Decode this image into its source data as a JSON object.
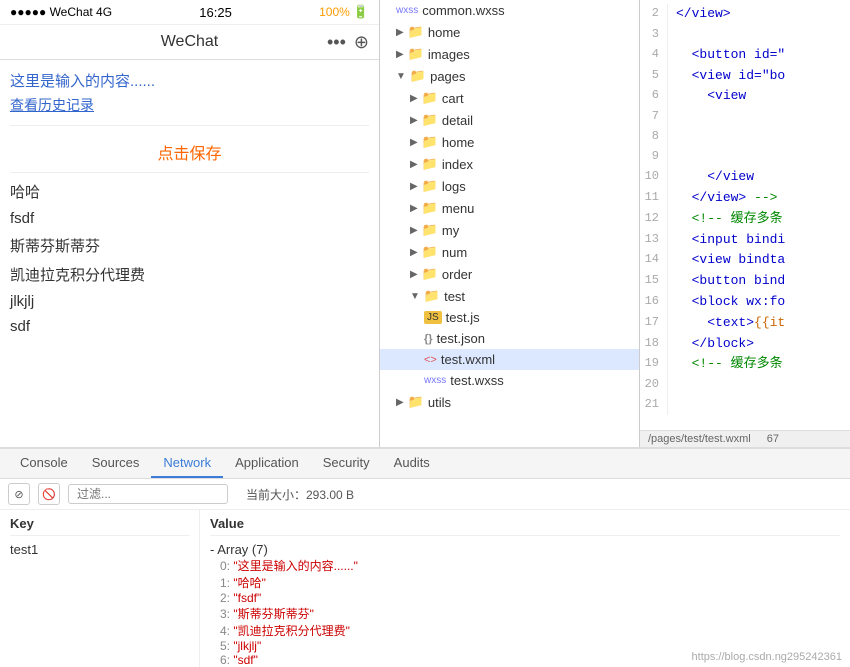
{
  "phone": {
    "status": {
      "signal": "●●●●● WeChat 4G",
      "time": "16:25",
      "battery": "100%",
      "battery_icon": "🔋"
    },
    "nav": {
      "title": "WeChat",
      "icon_dots": "•••",
      "icon_add": "⊕"
    },
    "content": {
      "input_text": "这里是输入的内容......",
      "link_text": "查看历史记录",
      "save_button": "点击保存",
      "list_items": [
        "哈哈",
        "fsdf",
        "斯蒂芬斯蒂芬",
        "凯迪拉克积分代理费",
        "jlkjlj",
        "sdf"
      ]
    }
  },
  "filetree": {
    "items": [
      {
        "level": 1,
        "type": "file",
        "icon": "wxss",
        "name": "common.wxss",
        "expanded": false,
        "active": false
      },
      {
        "level": 1,
        "type": "folder",
        "icon": "folder",
        "name": "home",
        "expanded": false,
        "arrow": "▶"
      },
      {
        "level": 1,
        "type": "folder",
        "icon": "folder",
        "name": "images",
        "expanded": false,
        "arrow": "▶"
      },
      {
        "level": 1,
        "type": "folder",
        "icon": "folder",
        "name": "pages",
        "expanded": true,
        "arrow": "▼"
      },
      {
        "level": 2,
        "type": "folder",
        "icon": "folder",
        "name": "cart",
        "expanded": false,
        "arrow": "▶"
      },
      {
        "level": 2,
        "type": "folder",
        "icon": "folder",
        "name": "detail",
        "expanded": false,
        "arrow": "▶"
      },
      {
        "level": 2,
        "type": "folder",
        "icon": "folder",
        "name": "home",
        "expanded": false,
        "arrow": "▶"
      },
      {
        "level": 2,
        "type": "folder",
        "icon": "folder",
        "name": "index",
        "expanded": false,
        "arrow": "▶"
      },
      {
        "level": 2,
        "type": "folder",
        "icon": "folder",
        "name": "logs",
        "expanded": false,
        "arrow": "▶"
      },
      {
        "level": 2,
        "type": "folder",
        "icon": "folder",
        "name": "menu",
        "expanded": false,
        "arrow": "▶"
      },
      {
        "level": 2,
        "type": "folder",
        "icon": "folder",
        "name": "my",
        "expanded": false,
        "arrow": "▶"
      },
      {
        "level": 2,
        "type": "folder",
        "icon": "folder",
        "name": "num",
        "expanded": false,
        "arrow": "▶"
      },
      {
        "level": 2,
        "type": "folder",
        "icon": "folder",
        "name": "order",
        "expanded": false,
        "arrow": "▶"
      },
      {
        "level": 2,
        "type": "folder",
        "icon": "folder",
        "name": "test",
        "expanded": true,
        "arrow": "▼"
      },
      {
        "level": 3,
        "type": "js",
        "icon": "js",
        "name": "test.js",
        "active": false
      },
      {
        "level": 3,
        "type": "json",
        "icon": "json",
        "name": "test.json",
        "active": false
      },
      {
        "level": 3,
        "type": "wxml",
        "icon": "wxml",
        "name": "test.wxml",
        "active": true
      },
      {
        "level": 3,
        "type": "wxss",
        "icon": "wxss",
        "name": "test.wxss",
        "active": false
      },
      {
        "level": 1,
        "type": "folder",
        "icon": "folder",
        "name": "utils",
        "expanded": false,
        "arrow": "▶"
      }
    ]
  },
  "editor": {
    "status_bar": {
      "file_path": "/pages/test/test.wxml",
      "col": "67"
    },
    "lines": [
      {
        "num": 2,
        "code": "  </view>"
      },
      {
        "num": 3,
        "code": ""
      },
      {
        "num": 4,
        "code": "  <button id=\""
      },
      {
        "num": 5,
        "code": "  <view id=\"bo"
      },
      {
        "num": 6,
        "code": "    <view"
      },
      {
        "num": 7,
        "code": ""
      },
      {
        "num": 8,
        "code": ""
      },
      {
        "num": 9,
        "code": ""
      },
      {
        "num": 10,
        "code": "    </view"
      },
      {
        "num": 11,
        "code": "  </view> -->"
      },
      {
        "num": 12,
        "code": "  <!-- 缓存多条"
      },
      {
        "num": 13,
        "code": "  <input bindi"
      },
      {
        "num": 14,
        "code": "  <view bindta"
      },
      {
        "num": 15,
        "code": "  <button bind"
      },
      {
        "num": 16,
        "code": "  <block wx:fo"
      },
      {
        "num": 17,
        "code": "    <text>{{it"
      },
      {
        "num": 18,
        "code": "  </block>"
      },
      {
        "num": 19,
        "code": "  <!-- 缓存多条"
      },
      {
        "num": 20,
        "code": ""
      },
      {
        "num": 21,
        "code": ""
      }
    ]
  },
  "bottom_panel": {
    "tabs": [
      {
        "id": "console",
        "label": "Console",
        "active": false
      },
      {
        "id": "sources",
        "label": "Sources",
        "active": false
      },
      {
        "id": "network",
        "label": "Network",
        "active": true
      },
      {
        "id": "application",
        "label": "Application",
        "active": false
      },
      {
        "id": "security",
        "label": "Security",
        "active": false
      },
      {
        "id": "audits",
        "label": "Audits",
        "active": false
      }
    ],
    "toolbar": {
      "filter_placeholder": "过滤...",
      "size_label": "当前大小：293.00 B"
    },
    "table": {
      "col_key": "Key",
      "col_value": "Value",
      "rows": [
        {
          "key": "test1",
          "value_type": "Array (7)",
          "items": [
            {
              "index": "0:",
              "value": "\"这里是输入的内容......\""
            },
            {
              "index": "1:",
              "value": "\"哈哈\""
            },
            {
              "index": "2:",
              "value": "\"fsdf\""
            },
            {
              "index": "3:",
              "value": "\"斯蒂芬斯蒂芬\""
            },
            {
              "index": "4:",
              "value": "\"凯迪拉克积分代理费\""
            },
            {
              "index": "5:",
              "value": "\"jlkjlj\""
            },
            {
              "index": "6:",
              "value": "\"sdf\""
            }
          ]
        }
      ]
    }
  },
  "watermark": "https://blog.csdn.ng295242361"
}
